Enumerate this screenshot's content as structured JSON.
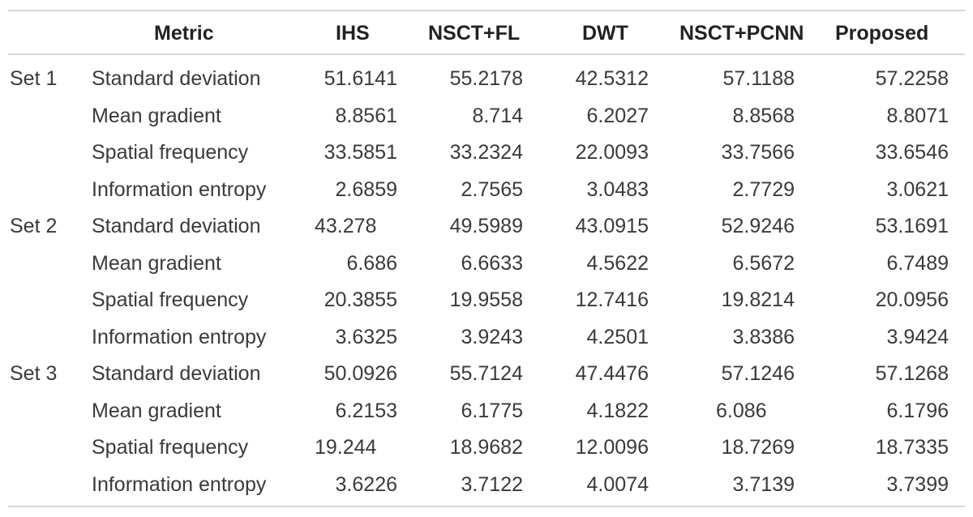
{
  "table": {
    "headers": [
      "",
      "Metric",
      "IHS",
      "NSCT+FL",
      "DWT",
      "NSCT+PCNN",
      "Proposed"
    ],
    "rows": [
      {
        "set": "Set 1",
        "metric": "Standard deviation",
        "values": [
          "51.6141",
          "55.2178",
          "42.5312",
          "57.1188",
          "57.2258"
        ]
      },
      {
        "set": "",
        "metric": "Mean gradient",
        "values": [
          "8.8561",
          "8.714",
          "6.2027",
          "8.8568",
          "8.8071"
        ]
      },
      {
        "set": "",
        "metric": "Spatial frequency",
        "values": [
          "33.5851",
          "33.2324",
          "22.0093",
          "33.7566",
          "33.6546"
        ]
      },
      {
        "set": "",
        "metric": "Information entropy",
        "values": [
          "2.6859",
          "2.7565",
          "3.0483",
          "2.7729",
          "3.0621"
        ]
      },
      {
        "set": "Set 2",
        "metric": "Standard deviation",
        "values": [
          "43.278",
          "49.5989",
          "43.0915",
          "52.9246",
          "53.1691"
        ]
      },
      {
        "set": "",
        "metric": "Mean gradient",
        "values": [
          "6.686",
          "6.6633",
          "4.5622",
          "6.5672",
          "6.7489"
        ]
      },
      {
        "set": "",
        "metric": "Spatial frequency",
        "values": [
          "20.3855",
          "19.9558",
          "12.7416",
          "19.8214",
          "20.0956"
        ]
      },
      {
        "set": "",
        "metric": "Information entropy",
        "values": [
          "3.6325",
          "3.9243",
          "4.2501",
          "3.8386",
          "3.9424"
        ]
      },
      {
        "set": "Set 3",
        "metric": "Standard deviation",
        "values": [
          "50.0926",
          "55.7124",
          "47.4476",
          "57.1246",
          "57.1268"
        ]
      },
      {
        "set": "",
        "metric": "Mean gradient",
        "values": [
          "6.2153",
          "6.1775",
          "4.1822",
          "6.086",
          "6.1796"
        ]
      },
      {
        "set": "",
        "metric": "Spatial frequency",
        "values": [
          "19.244",
          "18.9682",
          "12.0096",
          "18.7269",
          "18.7335"
        ]
      },
      {
        "set": "",
        "metric": "Information entropy",
        "values": [
          "3.6226",
          "3.7122",
          "4.0074",
          "3.7139",
          "3.7399"
        ]
      }
    ]
  }
}
